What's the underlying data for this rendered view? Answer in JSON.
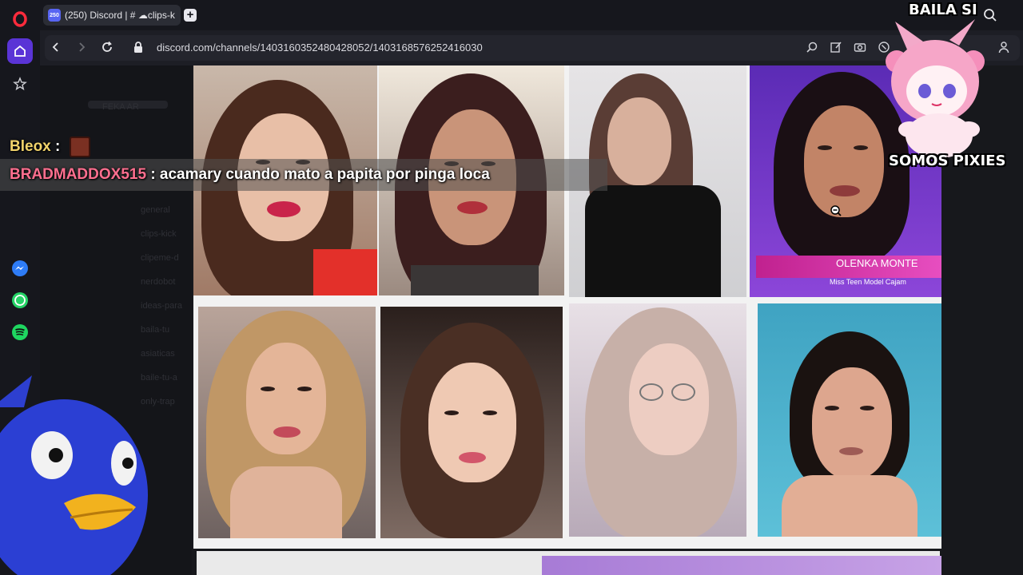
{
  "browser": {
    "tab": {
      "favicon_badge": "250",
      "title": "(250) Discord | # ☁clips-k"
    },
    "new_tab_symbol": "+",
    "url": "discord.com/channels/1403160352480428052/1403168576252416030"
  },
  "sidebar": {
    "items": [
      {
        "name": "home"
      },
      {
        "name": "bookmarks"
      },
      {
        "name": "messenger"
      },
      {
        "name": "whatsapp"
      },
      {
        "name": "spotify"
      }
    ]
  },
  "discord_background": {
    "channels": [
      "FEKA AR",
      "general",
      "clips-kick",
      "clipeme-d",
      "nerdobot",
      "ideas-para",
      "baila-tu",
      "asiaticas",
      "baile-tu-a",
      "only-trap"
    ]
  },
  "image_grid": {
    "tiles": [
      {
        "caption": ""
      },
      {
        "caption": ""
      },
      {
        "caption": ""
      },
      {
        "caption": "OLENKA MONTE",
        "subcaption": "Miss Teen Model Cajam"
      },
      {
        "caption": ""
      },
      {
        "caption": ""
      },
      {
        "caption": ""
      },
      {
        "caption": ""
      }
    ]
  },
  "chat_overlay": {
    "messages": [
      {
        "user": "Bleox",
        "separator": ":",
        "text": ""
      },
      {
        "user": "BRADMADDOX515",
        "separator": ":",
        "text": "acamary cuando mato a papita por pinga loca"
      }
    ]
  },
  "sticker": {
    "top_text": "BAILA SI",
    "bottom_text": "SOMOS PIXIES"
  },
  "colors": {
    "accent": "#5a34d6",
    "discord_blurple": "#5865f2",
    "nick_1": "#f1d36b",
    "nick_2": "#ff6f8f"
  }
}
